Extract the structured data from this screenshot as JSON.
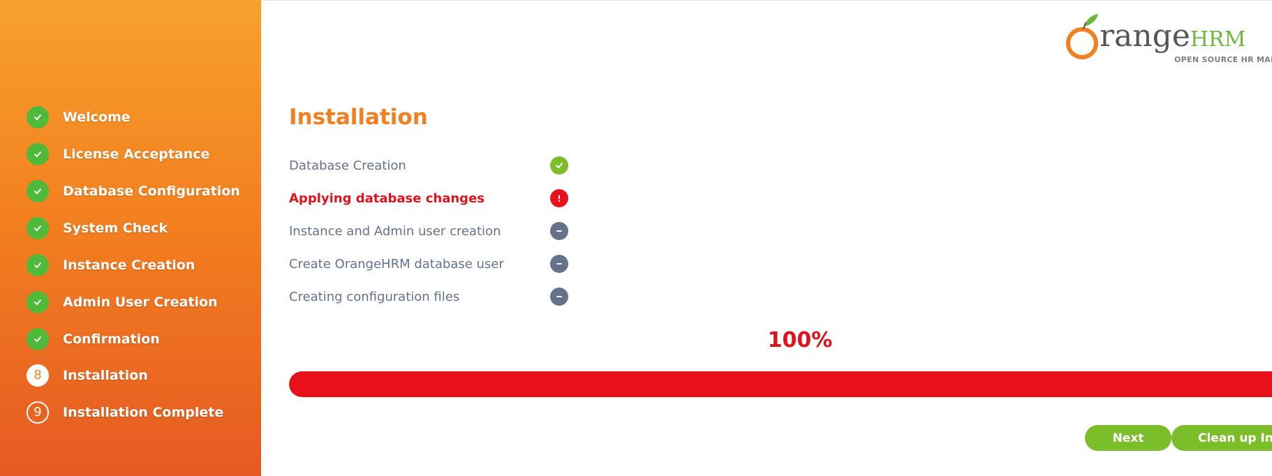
{
  "sidebar": {
    "steps": [
      {
        "label": "Welcome",
        "state": "done"
      },
      {
        "label": "License Acceptance",
        "state": "done"
      },
      {
        "label": "Database Configuration",
        "state": "done"
      },
      {
        "label": "System Check",
        "state": "done"
      },
      {
        "label": "Instance Creation",
        "state": "done"
      },
      {
        "label": "Admin User Creation",
        "state": "done"
      },
      {
        "label": "Confirmation",
        "state": "done"
      },
      {
        "label": "Installation",
        "state": "current",
        "number": "8"
      },
      {
        "label": "Installation Complete",
        "state": "pending",
        "number": "9"
      }
    ]
  },
  "logo": {
    "initial": "O",
    "word": "range",
    "suffix": "HRM",
    "tagline": "OPEN SOURCE HR MANA",
    "icon": "orange-fruit-logo"
  },
  "main": {
    "title": "Installation",
    "tasks": [
      {
        "label": "Database Creation",
        "status": "success",
        "icon": "check-icon"
      },
      {
        "label": "Applying database changes",
        "status": "error",
        "icon": "exclamation-icon"
      },
      {
        "label": "Instance and Admin user creation",
        "status": "pending",
        "icon": "minus-icon"
      },
      {
        "label": "Create OrangeHRM database user",
        "status": "pending",
        "icon": "minus-icon"
      },
      {
        "label": "Creating configuration files",
        "status": "pending",
        "icon": "minus-icon"
      }
    ],
    "progress_text": "100%",
    "progress_value": 100
  },
  "buttons": {
    "next": "Next",
    "cleanup": "Clean up Inst"
  },
  "colors": {
    "brand_orange": "#f38020",
    "success_green": "#7cbd2a",
    "step_green": "#4fba3a",
    "error_red": "#e8111b",
    "pending_gray": "#64728c"
  }
}
